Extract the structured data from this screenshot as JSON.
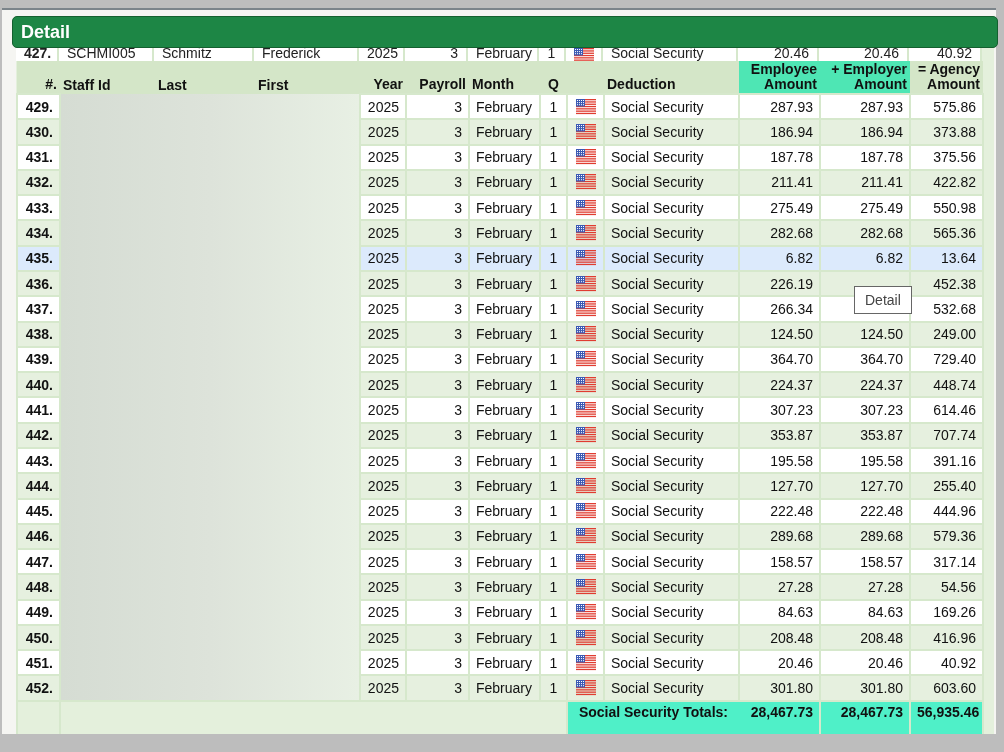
{
  "panel": {
    "title": "Detail"
  },
  "columns": [
    {
      "label": "#.",
      "highlighted": false
    },
    {
      "label": "Staff Id",
      "highlighted": false
    },
    {
      "label": "Last",
      "highlighted": false
    },
    {
      "label": "First",
      "highlighted": false
    },
    {
      "label": "Year",
      "highlighted": false
    },
    {
      "label": "Payroll",
      "highlighted": false
    },
    {
      "label": "Month",
      "highlighted": false
    },
    {
      "label": "Q",
      "highlighted": false
    },
    {
      "highlighted": false
    },
    {
      "label": "Deduction",
      "highlighted": false
    },
    {
      "label": "Employee Amount",
      "highlighted": true
    },
    {
      "label": "+ Employer Amount",
      "highlighted": true
    },
    {
      "label": "= Agency Amount",
      "highlighted": false
    }
  ],
  "scrolled_row": {
    "num": "427.",
    "staff_id": "SCHMI005",
    "last": "Schmitz",
    "first": "Frederick",
    "year": "2025",
    "payroll": "3",
    "month": "February",
    "q": "1",
    "deduction": "Social Security",
    "employee": "20.46",
    "employer": "20.46",
    "agency": "40.92"
  },
  "rows": [
    {
      "num": "429.",
      "year": "2025",
      "payroll": "3",
      "month": "February",
      "q": "1",
      "deduction": "Social Security",
      "employee": "287.93",
      "employer": "287.93",
      "agency": "575.86",
      "selected": false
    },
    {
      "num": "430.",
      "year": "2025",
      "payroll": "3",
      "month": "February",
      "q": "1",
      "deduction": "Social Security",
      "employee": "186.94",
      "employer": "186.94",
      "agency": "373.88",
      "selected": false
    },
    {
      "num": "431.",
      "year": "2025",
      "payroll": "3",
      "month": "February",
      "q": "1",
      "deduction": "Social Security",
      "employee": "187.78",
      "employer": "187.78",
      "agency": "375.56",
      "selected": false
    },
    {
      "num": "432.",
      "year": "2025",
      "payroll": "3",
      "month": "February",
      "q": "1",
      "deduction": "Social Security",
      "employee": "211.41",
      "employer": "211.41",
      "agency": "422.82",
      "selected": false
    },
    {
      "num": "433.",
      "year": "2025",
      "payroll": "3",
      "month": "February",
      "q": "1",
      "deduction": "Social Security",
      "employee": "275.49",
      "employer": "275.49",
      "agency": "550.98",
      "selected": false
    },
    {
      "num": "434.",
      "year": "2025",
      "payroll": "3",
      "month": "February",
      "q": "1",
      "deduction": "Social Security",
      "employee": "282.68",
      "employer": "282.68",
      "agency": "565.36",
      "selected": false
    },
    {
      "num": "435.",
      "year": "2025",
      "payroll": "3",
      "month": "February",
      "q": "1",
      "deduction": "Social Security",
      "employee": "6.82",
      "employer": "6.82",
      "agency": "13.64",
      "selected": true
    },
    {
      "num": "436.",
      "year": "2025",
      "payroll": "3",
      "month": "February",
      "q": "1",
      "deduction": "Social Security",
      "employee": "226.19",
      "agency": "452.38",
      "selected": false
    },
    {
      "num": "437.",
      "year": "2025",
      "payroll": "3",
      "month": "February",
      "q": "1",
      "deduction": "Social Security",
      "employee": "266.34",
      "agency": "532.68",
      "selected": false
    },
    {
      "num": "438.",
      "year": "2025",
      "payroll": "3",
      "month": "February",
      "q": "1",
      "deduction": "Social Security",
      "employee": "124.50",
      "employer": "124.50",
      "agency": "249.00",
      "selected": false
    },
    {
      "num": "439.",
      "year": "2025",
      "payroll": "3",
      "month": "February",
      "q": "1",
      "deduction": "Social Security",
      "employee": "364.70",
      "employer": "364.70",
      "agency": "729.40",
      "selected": false
    },
    {
      "num": "440.",
      "year": "2025",
      "payroll": "3",
      "month": "February",
      "q": "1",
      "deduction": "Social Security",
      "employee": "224.37",
      "employer": "224.37",
      "agency": "448.74",
      "selected": false
    },
    {
      "num": "441.",
      "year": "2025",
      "payroll": "3",
      "month": "February",
      "q": "1",
      "deduction": "Social Security",
      "employee": "307.23",
      "employer": "307.23",
      "agency": "614.46",
      "selected": false
    },
    {
      "num": "442.",
      "year": "2025",
      "payroll": "3",
      "month": "February",
      "q": "1",
      "deduction": "Social Security",
      "employee": "353.87",
      "employer": "353.87",
      "agency": "707.74",
      "selected": false
    },
    {
      "num": "443.",
      "year": "2025",
      "payroll": "3",
      "month": "February",
      "q": "1",
      "deduction": "Social Security",
      "employee": "195.58",
      "employer": "195.58",
      "agency": "391.16",
      "selected": false
    },
    {
      "num": "444.",
      "year": "2025",
      "payroll": "3",
      "month": "February",
      "q": "1",
      "deduction": "Social Security",
      "employee": "127.70",
      "employer": "127.70",
      "agency": "255.40",
      "selected": false
    },
    {
      "num": "445.",
      "year": "2025",
      "payroll": "3",
      "month": "February",
      "q": "1",
      "deduction": "Social Security",
      "employee": "222.48",
      "employer": "222.48",
      "agency": "444.96",
      "selected": false
    },
    {
      "num": "446.",
      "year": "2025",
      "payroll": "3",
      "month": "February",
      "q": "1",
      "deduction": "Social Security",
      "employee": "289.68",
      "employer": "289.68",
      "agency": "579.36",
      "selected": false
    },
    {
      "num": "447.",
      "year": "2025",
      "payroll": "3",
      "month": "February",
      "q": "1",
      "deduction": "Social Security",
      "employee": "158.57",
      "employer": "158.57",
      "agency": "317.14",
      "selected": false
    },
    {
      "num": "448.",
      "year": "2025",
      "payroll": "3",
      "month": "February",
      "q": "1",
      "deduction": "Social Security",
      "employee": "27.28",
      "employer": "27.28",
      "agency": "54.56",
      "selected": false
    },
    {
      "num": "449.",
      "year": "2025",
      "payroll": "3",
      "month": "February",
      "q": "1",
      "deduction": "Social Security",
      "employee": "84.63",
      "employer": "84.63",
      "agency": "169.26",
      "selected": false
    },
    {
      "num": "450.",
      "year": "2025",
      "payroll": "3",
      "month": "February",
      "q": "1",
      "deduction": "Social Security",
      "employee": "208.48",
      "employer": "208.48",
      "agency": "416.96",
      "selected": false
    },
    {
      "num": "451.",
      "year": "2025",
      "payroll": "3",
      "month": "February",
      "q": "1",
      "deduction": "Social Security",
      "employee": "20.46",
      "employer": "20.46",
      "agency": "40.92",
      "selected": false
    },
    {
      "num": "452.",
      "year": "2025",
      "payroll": "3",
      "month": "February",
      "q": "1",
      "deduction": "Social Security",
      "employee": "301.80",
      "employer": "301.80",
      "agency": "603.60",
      "selected": false
    }
  ],
  "totals": {
    "label": "Social Security Totals:",
    "employee": "28,467.73",
    "employer": "28,467.73",
    "agency": "56,935.46"
  },
  "tooltip": {
    "text": "Detail"
  }
}
